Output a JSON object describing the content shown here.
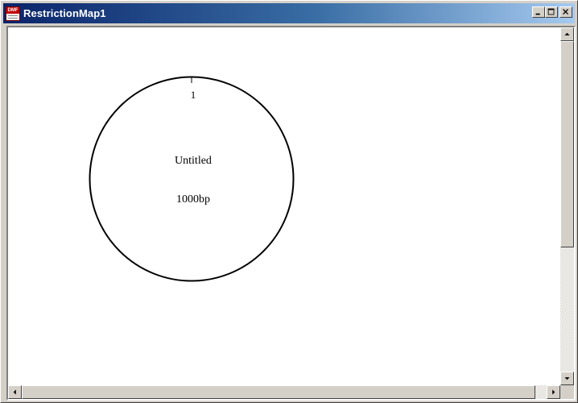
{
  "window": {
    "title": "RestrictionMap1",
    "app_icon": "dnaman-doc-icon",
    "app_icon_text": "DMF",
    "controls": [
      "minimize-icon",
      "maximize-icon",
      "close-icon"
    ]
  },
  "map": {
    "name": "Untitled",
    "length": "1000bp",
    "origin_label": "1"
  },
  "scrollbars": {
    "vertical": {
      "up_icon": "arrow-up-icon",
      "down_icon": "arrow-down-icon"
    },
    "horizontal": {
      "left_icon": "arrow-left-icon",
      "right_icon": "arrow-right-icon"
    }
  },
  "colors": {
    "titlebar_start": "#0a246a",
    "titlebar_end": "#a6caf0",
    "chrome": "#d4d0c8",
    "canvas": "#ffffff"
  }
}
